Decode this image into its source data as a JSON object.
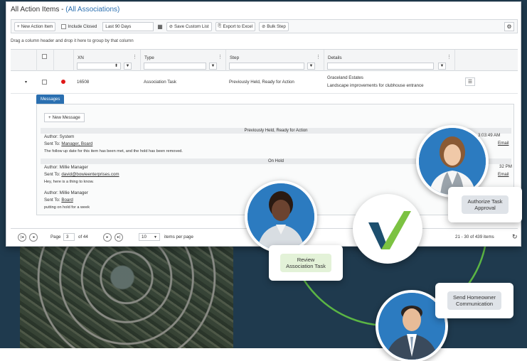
{
  "window": {
    "title": "All Action Items - ",
    "title_link": "(All Associations)"
  },
  "toolbar": {
    "new_action_item": "New Action Item",
    "include_closed": "Include Closed",
    "date_range": "Last 90 Days",
    "save_custom_list": "Save Custom List",
    "export_to_excel": "Export to Excel",
    "bulk_step": "Bulk Step"
  },
  "grid": {
    "group_hint": "Drag a column header and drop it here to group by that column",
    "columns": [
      "XN",
      "Type",
      "Step",
      "Details"
    ],
    "row": {
      "xn": "16508",
      "type": "Association Task",
      "step": "Previously Held, Ready for Action",
      "details_line1": "Graceland Estates",
      "details_line2": "Landscape improvements for clubhouse entrance"
    }
  },
  "messages": {
    "tab": "Messages",
    "new_message": "New Message",
    "groups": [
      {
        "header": "Previously Held, Ready for Action",
        "author": "Author: System",
        "sent_to_label": "Sent To: ",
        "sent_to": "Manager, Board",
        "body": "The follow up date for this item has been met, and the hold has been removed.",
        "time": "3:03:49 AM",
        "channel": "Email"
      },
      {
        "header": "On Hold",
        "author": "Author: Millie Manager",
        "sent_to_label": "Sent To: ",
        "sent_to": "david@bowieenterprises.com",
        "body": "Hey, here is a thing to know.",
        "time": "32 PM",
        "channel": "Email"
      },
      {
        "author": "Author: Millie Manager",
        "sent_to_label": "Sent To: ",
        "sent_to": "Board",
        "body": "putting on hold for a week"
      }
    ]
  },
  "pager": {
    "page_label": "Page",
    "page": "3",
    "of_label": "of 44",
    "page_size": "10",
    "per_page_label": "items per page",
    "range": "21 - 30 of 439 items"
  },
  "workflow": {
    "review": "Review\nAssociation Task",
    "authorize": "Authorize Task\nApproval",
    "send": "Send Homeowner\nCommunication"
  },
  "colors": {
    "background": "#1f3a4e",
    "accent_blue": "#2a6fb0",
    "orbit_green": "#5bb544",
    "review_pill": "#e3f2d8",
    "gray_pill": "#dfe3e8",
    "logo_green": "#7cc242",
    "logo_navy": "#1d4f6e"
  }
}
